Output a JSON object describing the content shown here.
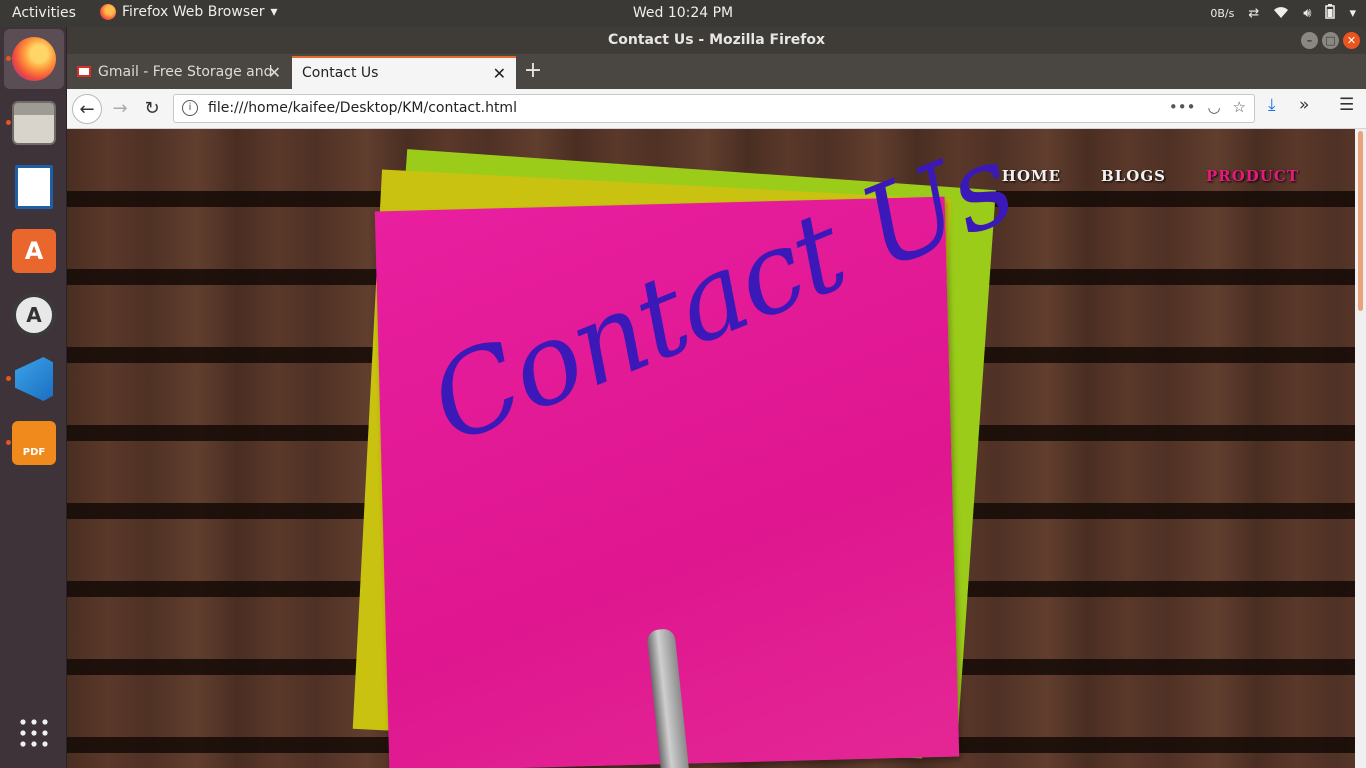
{
  "topbar": {
    "activities": "Activities",
    "app_menu": "Firefox Web Browser",
    "clock": "Wed 10:24 PM",
    "net_speed": "0B/s"
  },
  "dock": {
    "items": [
      {
        "name": "Firefox",
        "icon": "firefox-icon",
        "active": true
      },
      {
        "name": "Files",
        "icon": "files-icon"
      },
      {
        "name": "LibreOffice Writer",
        "icon": "writer-icon"
      },
      {
        "name": "Ubuntu Software",
        "icon": "software-icon"
      },
      {
        "name": "Software Updater",
        "icon": "updater-icon"
      },
      {
        "name": "Visual Studio Code",
        "icon": "vscode-icon"
      },
      {
        "name": "Foxit PDF",
        "icon": "pdf-icon"
      }
    ],
    "apps_grid_icon": "grid-icon"
  },
  "window": {
    "title": "Contact Us - Mozilla Firefox"
  },
  "tabs": [
    {
      "label": "Gmail - Free Storage and",
      "active": false
    },
    {
      "label": "Contact Us",
      "active": true
    }
  ],
  "navbar": {
    "url": "file:///home/kaifee/Desktop/KM/contact.html"
  },
  "page": {
    "hero_text": "Contact Us",
    "nav": [
      {
        "label": "HOME"
      },
      {
        "label": "BLOGS"
      },
      {
        "label": "PRODUCT",
        "current": true
      }
    ],
    "accent_color": "#e6197d"
  }
}
